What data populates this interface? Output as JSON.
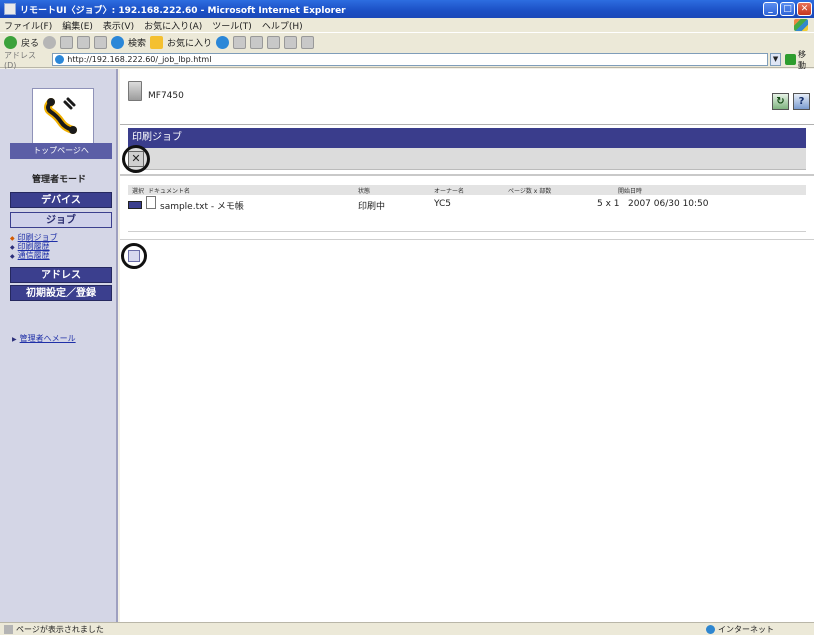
{
  "window": {
    "title": "リモートUI〈ジョブ〉: 192.168.222.60 - Microsoft Internet Explorer"
  },
  "menu": [
    "ファイル(F)",
    "編集(E)",
    "表示(V)",
    "お気に入り(A)",
    "ツール(T)",
    "ヘルプ(H)"
  ],
  "toolbar": {
    "back_label": "戻る",
    "search_label": "検索",
    "favorites_label": "お気に入り"
  },
  "address": {
    "label": "アドレス(D)",
    "url": "http://192.168.222.60/_job_lbp.html",
    "go_label": "移動"
  },
  "sidebar": {
    "top_page_label": "トップページへ",
    "mode_label": "管理者モード",
    "nav": {
      "device": "デバイス",
      "job": "ジョブ",
      "address": "アドレス",
      "settings": "初期設定／登録"
    },
    "job_subitems": [
      "印刷ジョブ",
      "印刷履歴",
      "通信履歴"
    ],
    "admin_mail": "管理者へメール"
  },
  "header": {
    "device_name": "MF7450",
    "refresh_icon": "↻",
    "help_icon": "?"
  },
  "section": {
    "title": "印刷ジョブ",
    "cancel_icon": "✕"
  },
  "table": {
    "columns": [
      "選択",
      "ドキュメント名",
      "状態",
      "オーナー名",
      "ページ数 x 部数",
      "開始日時"
    ],
    "rows": [
      {
        "document": "sample.txt - メモ帳",
        "status": "印刷中",
        "owner": "YC5",
        "pages_copies": "5 x 1",
        "start": "2007 06/30 10:50"
      }
    ]
  },
  "statusbar": {
    "message": "ページが表示されました",
    "zone": "インターネット"
  },
  "colors": {
    "nav_dark": "#3b3f8e",
    "section_bar": "#3a3d8c",
    "titlebar": "#1b4fc4"
  }
}
